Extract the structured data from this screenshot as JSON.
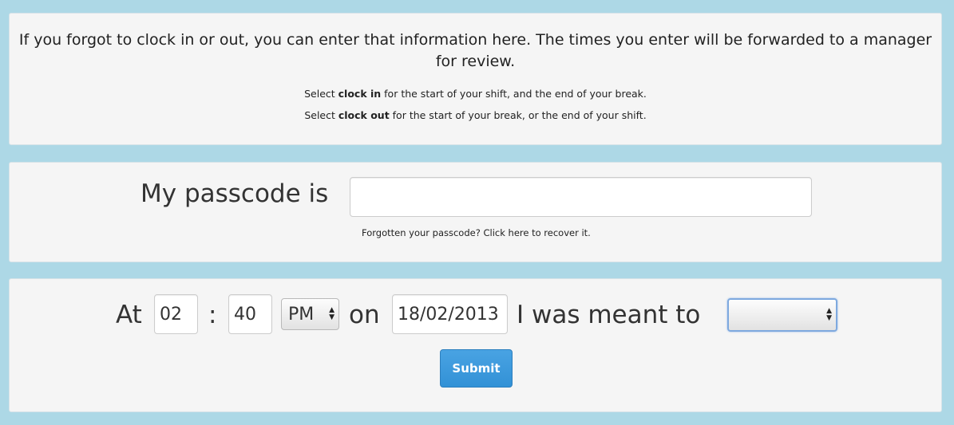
{
  "info": {
    "intro": "If you forgot to clock in or out, you can enter that information here. The times you enter will be forwarded to a manager for review.",
    "hint_clock_in": {
      "prefix": "Select ",
      "emphasis": "clock in",
      "suffix": " for the start of your shift, and the end of your break."
    },
    "hint_clock_out": {
      "prefix": "Select ",
      "emphasis": "clock out",
      "suffix": " for the start of your break, or the end of your shift."
    }
  },
  "passcode": {
    "label": "My passcode is",
    "value": "",
    "forgot_link": "Forgotten your passcode? Click here to recover it."
  },
  "entry": {
    "at_label": "At",
    "hour": "02",
    "colon": ":",
    "minute": "40",
    "ampm": "PM",
    "on_label": "on",
    "date": "18/02/2013",
    "meant_label": "I was meant to",
    "action_value": "",
    "submit_label": "Submit"
  },
  "colors": {
    "background": "#add8e6",
    "panel": "#f5f5f5",
    "submit_button": "#3a98dc"
  },
  "icons": {
    "select_arrows": "up-down-arrows-icon"
  }
}
